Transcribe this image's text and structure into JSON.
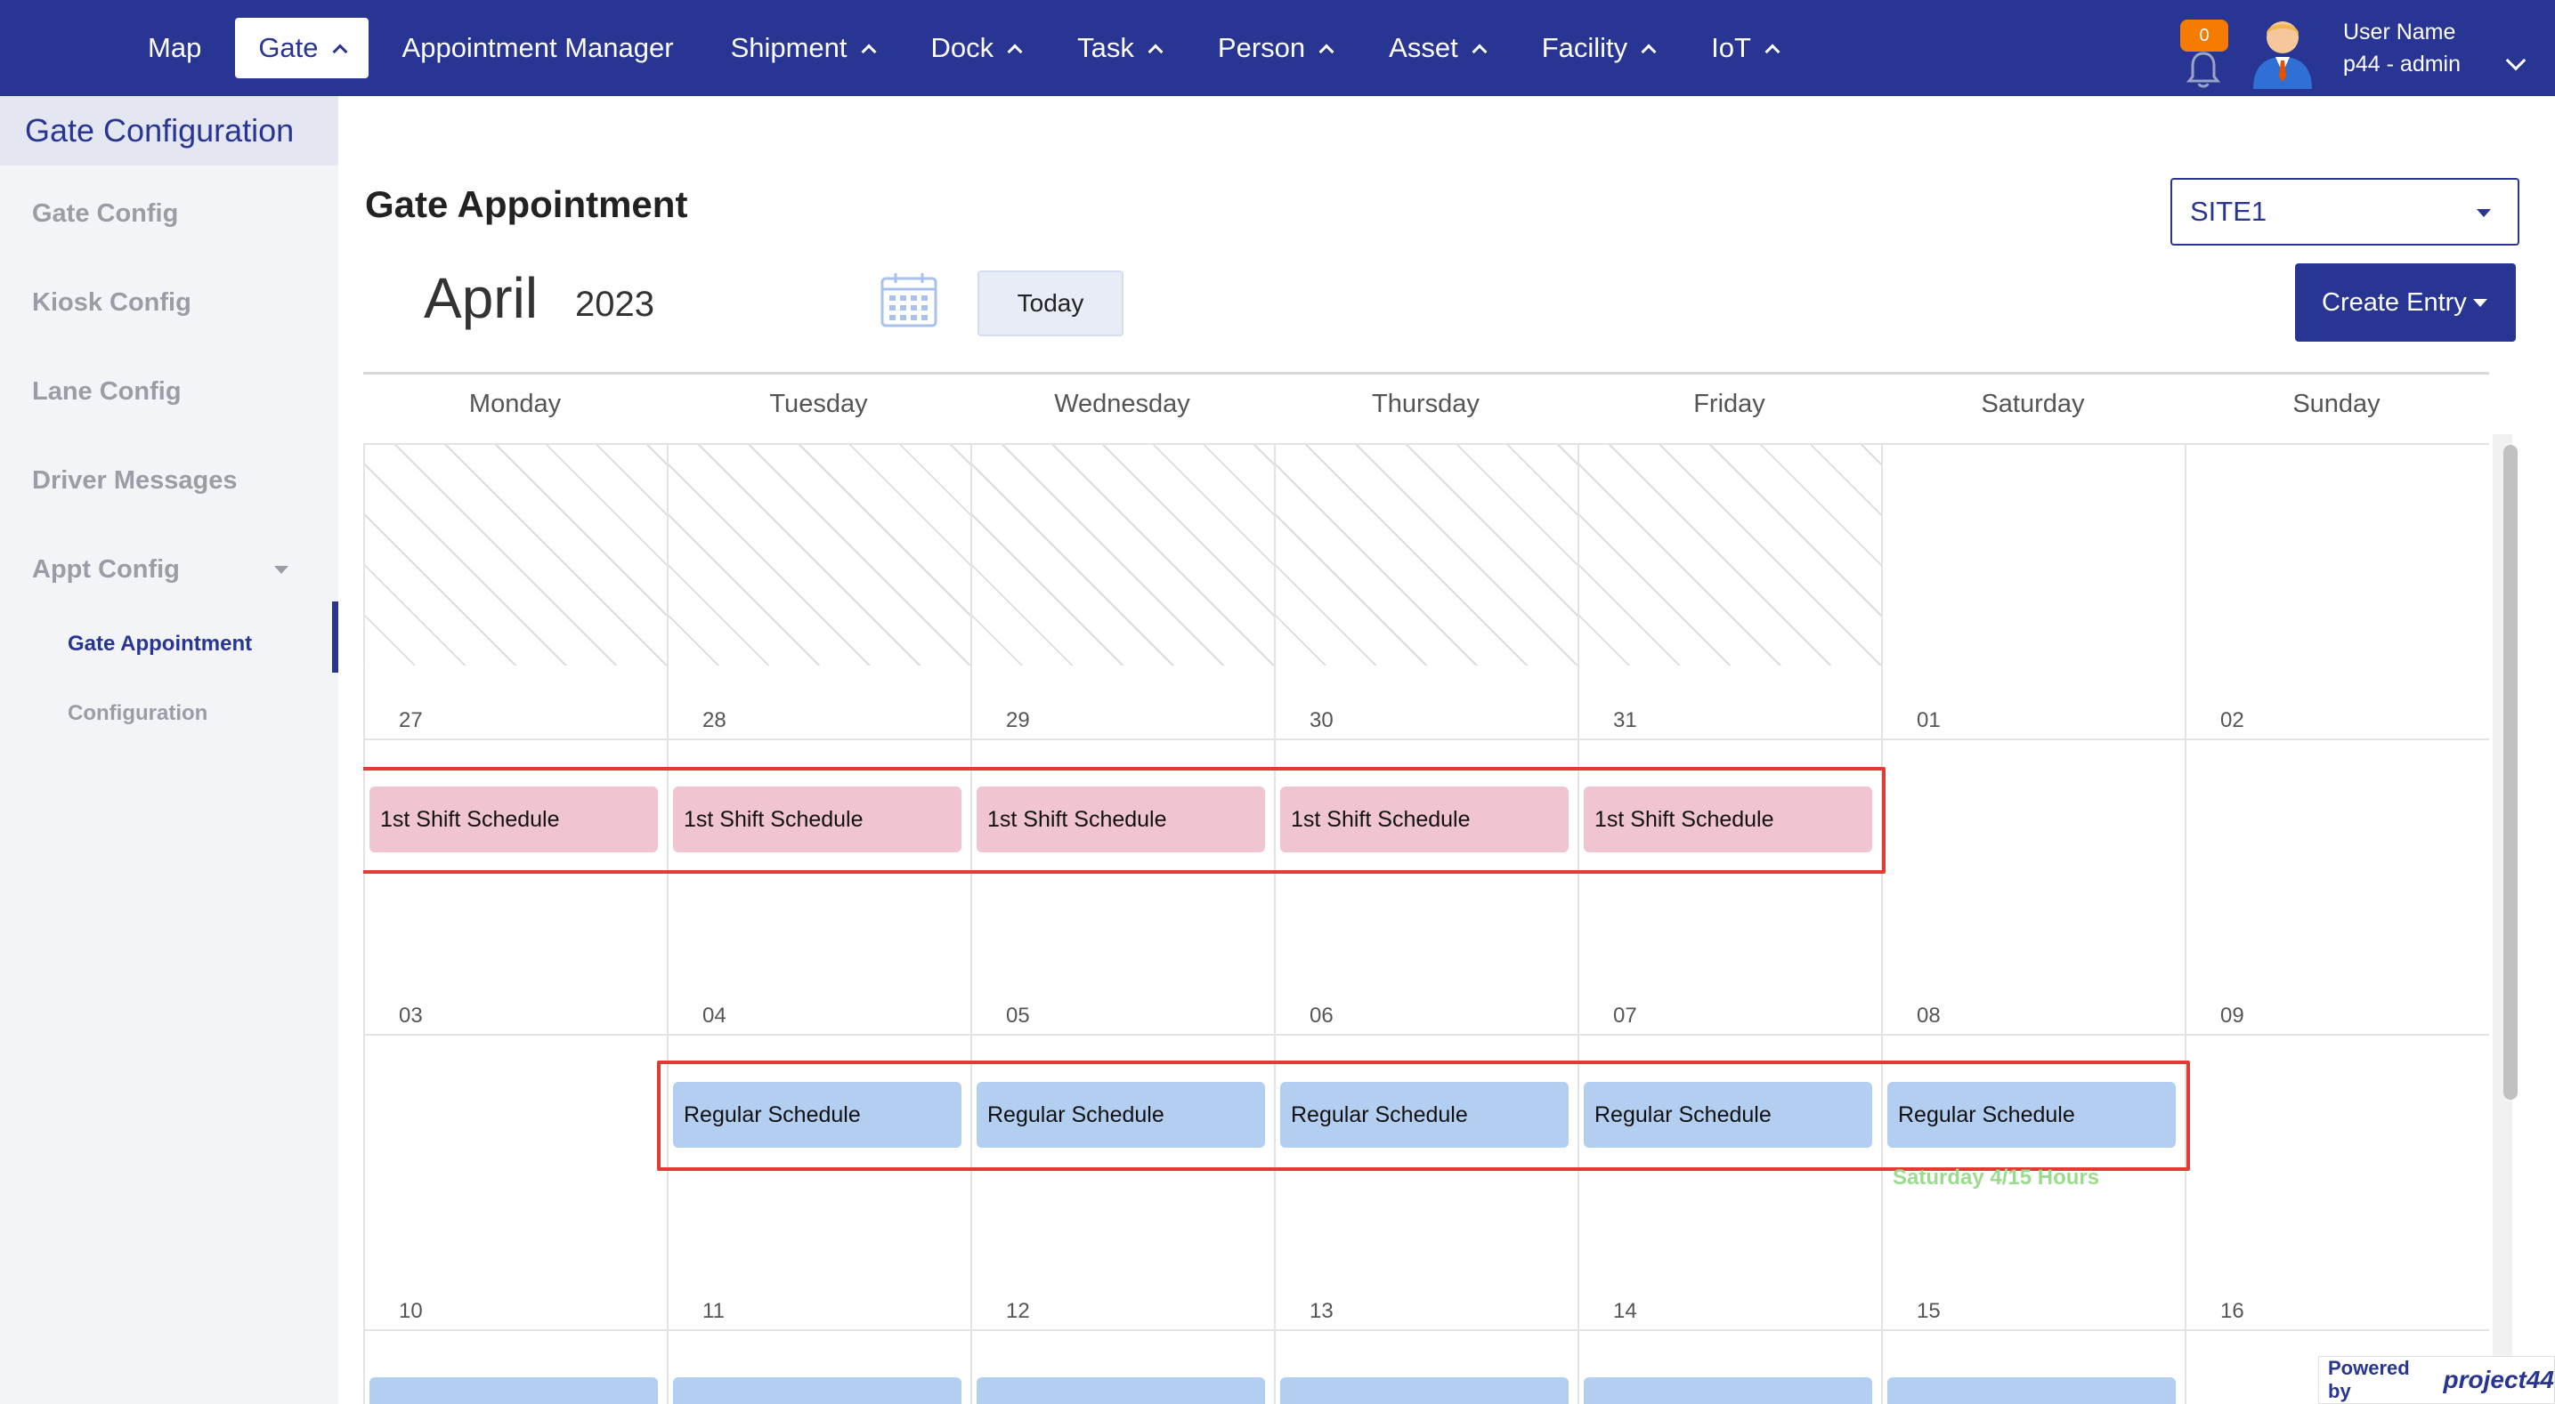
{
  "nav": {
    "items": [
      {
        "label": "Map",
        "chevron": false,
        "active": false
      },
      {
        "label": "Gate",
        "chevron": true,
        "active": true
      },
      {
        "label": "Appointment Manager",
        "chevron": false,
        "active": false
      },
      {
        "label": "Shipment",
        "chevron": true,
        "active": false
      },
      {
        "label": "Dock",
        "chevron": true,
        "active": false
      },
      {
        "label": "Task",
        "chevron": true,
        "active": false
      },
      {
        "label": "Person",
        "chevron": true,
        "active": false
      },
      {
        "label": "Asset",
        "chevron": true,
        "active": false
      },
      {
        "label": "Facility",
        "chevron": true,
        "active": false
      },
      {
        "label": "IoT",
        "chevron": true,
        "active": false
      }
    ],
    "notification_count": "0",
    "user_name": "User Name",
    "user_role": "p44 - admin"
  },
  "sidebar": {
    "title": "Gate Configuration",
    "items": [
      "Gate Config",
      "Kiosk Config",
      "Lane Config",
      "Driver Messages",
      "Appt Config"
    ],
    "sub_items": [
      "Gate Appointment",
      "Configuration"
    ]
  },
  "main": {
    "title": "Gate Appointment",
    "site": "SITE1",
    "month": "April",
    "year": "2023",
    "today_label": "Today",
    "create_label": "Create Entry"
  },
  "calendar": {
    "days": [
      "Monday",
      "Tuesday",
      "Wednesday",
      "Thursday",
      "Friday",
      "Saturday",
      "Sunday"
    ],
    "weeks": [
      [
        "27",
        "28",
        "29",
        "30",
        "31",
        "01",
        "02"
      ],
      [
        "03",
        "04",
        "05",
        "06",
        "07",
        "08",
        "09"
      ],
      [
        "10",
        "11",
        "12",
        "13",
        "14",
        "15",
        "16"
      ]
    ],
    "shift_label": "1st Shift Schedule",
    "regular_label": "Regular Schedule",
    "saturday_note": "Saturday 4/15 Hours"
  },
  "footer": {
    "powered_by": "Powered by",
    "brand": "project44"
  },
  "colors": {
    "primary": "#283593",
    "pink_event": "#f0c4d0",
    "blue_event": "#b2cff2",
    "highlight": "#e53935",
    "badge": "#f57c00"
  }
}
